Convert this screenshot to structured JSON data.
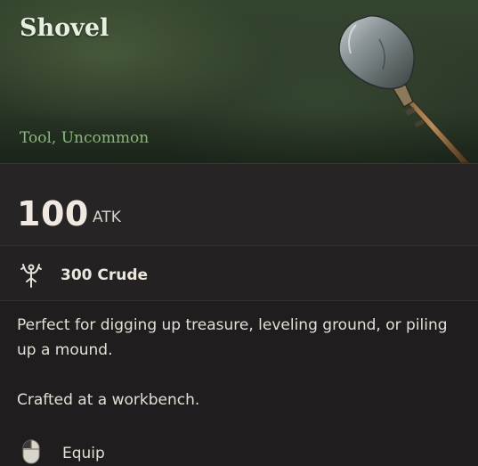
{
  "item": {
    "name": "Shovel",
    "subtitle": "Tool, Uncommon",
    "art_icon": "shovel-icon"
  },
  "stats": {
    "atk_value": "100",
    "atk_unit": "ATK"
  },
  "cost": {
    "icon": "crude-resource-icon",
    "text": "300 Crude"
  },
  "description": {
    "paragraphs": [
      "Perfect for digging up treasure, leveling ground, or piling up a mound.",
      "Crafted at a workbench."
    ]
  },
  "actions": {
    "equip_icon": "mouse-left-click-icon",
    "equip_label": "Equip"
  },
  "colors": {
    "header_green": "#2c3a29",
    "rarity_green": "#9ed58a",
    "panel_bg": "#1f1d1e"
  }
}
